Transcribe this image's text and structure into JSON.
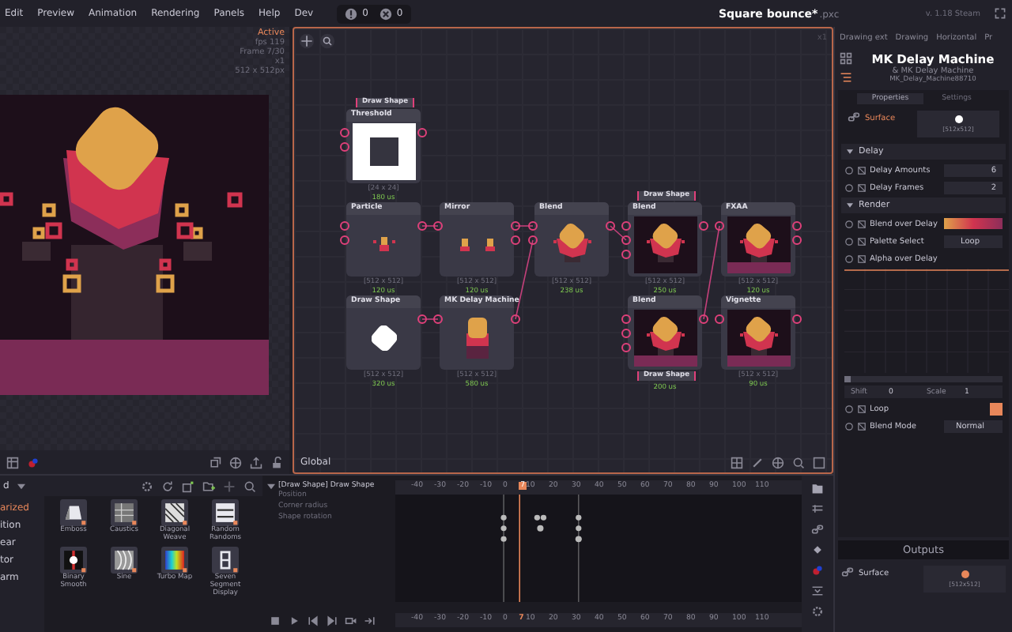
{
  "menu": [
    {
      "label": "Edit"
    },
    {
      "label": "Preview"
    },
    {
      "label": "Animation"
    },
    {
      "label": "Rendering"
    },
    {
      "label": "Panels"
    },
    {
      "label": "Help"
    },
    {
      "label": "Dev"
    }
  ],
  "counts": [
    {
      "kind": "warning",
      "count": "0"
    },
    {
      "kind": "error",
      "count": "0"
    }
  ],
  "title": "Square bounce*",
  "title_ext": ".pxc",
  "version": "v. 1.18 Steam",
  "preview": {
    "status": "Active",
    "info": [
      "fps 119",
      "Frame 7/30",
      "x1",
      "512 x 512px"
    ]
  },
  "graph": {
    "zoom": "x1",
    "scope": "Global",
    "nodes": [
      {
        "name": "Threshold",
        "tag_top": "Draw Shape",
        "size": "[24 x 24]",
        "time": "180 us",
        "kind": "frame"
      },
      {
        "name": "Particle",
        "size": "[512 x 512]",
        "time": "120 us",
        "kind": "particles"
      },
      {
        "name": "Mirror",
        "size": "[512 x 512]",
        "time": "120 us",
        "kind": "mirror"
      },
      {
        "name": "Blend",
        "size": "[512 x 512]",
        "time": "238 us",
        "kind": "sprite"
      },
      {
        "name": "Blend",
        "tag_top": "Draw Shape",
        "size": "[512 x 512]",
        "time": "250 us",
        "kind": "scene"
      },
      {
        "name": "FXAA",
        "size": "[512 x 512]",
        "time": "120 us",
        "kind": "scene_band"
      },
      {
        "name": "Draw Shape",
        "size": "[512 x 512]",
        "time": "320 us",
        "kind": "blob"
      },
      {
        "name": "MK Delay Machine",
        "size": "[512 x 512]",
        "time": "580 us",
        "kind": "tall"
      },
      {
        "name": "Blend",
        "tag_bottom": "Draw Shape",
        "time": "200 us",
        "kind": "scene_band"
      },
      {
        "name": "Vignette",
        "size": "[512 x 512]",
        "time": "90 us",
        "kind": "scene_band"
      }
    ]
  },
  "inspector": {
    "tabs": [
      {
        "label": "Drawing ext"
      },
      {
        "label": "Drawing"
      },
      {
        "label": "Horizontal"
      },
      {
        "label": "Pr"
      }
    ],
    "node_title": "MK Delay Machine",
    "node_type": "& MK Delay Machine",
    "node_id": "MK_Delay_Machine88710",
    "prop_tabs": [
      {
        "label": "Properties",
        "selected": true
      },
      {
        "label": "Settings",
        "selected": false
      }
    ],
    "input": {
      "label": "Surface",
      "size": "[512x512]"
    },
    "sections": [
      {
        "title": "Delay",
        "expanded": true,
        "props": [
          {
            "kind": "number",
            "label": "Delay Amounts",
            "value": "6"
          },
          {
            "kind": "number",
            "label": "Delay Frames",
            "value": "2"
          }
        ]
      },
      {
        "title": "Render",
        "expanded": true,
        "props": [
          {
            "kind": "gradient",
            "label": "Blend over Delay"
          },
          {
            "kind": "select",
            "label": "Palette Select",
            "value": "Loop"
          },
          {
            "kind": "curve",
            "label": "Alpha over Delay",
            "shift_label": "Shift",
            "shift": "0",
            "scale_label": "Scale",
            "scale": "1"
          },
          {
            "kind": "checkbox",
            "label": "Loop",
            "checked": true
          },
          {
            "kind": "select",
            "label": "Blend Mode",
            "value": "Normal"
          }
        ]
      }
    ],
    "outputs_title": "Outputs",
    "outputs": [
      {
        "label": "Surface",
        "size": "[512x512]"
      }
    ]
  },
  "library": {
    "category": "d",
    "groups": [
      {
        "label": "arized",
        "selected": true
      },
      {
        "label": "ition",
        "selected": false
      },
      {
        "label": "ear",
        "selected": false
      },
      {
        "label": "tor",
        "selected": false
      },
      {
        "label": "arm",
        "selected": false
      }
    ],
    "items": [
      {
        "label": "Emboss",
        "kind": "emboss"
      },
      {
        "label": "Caustics",
        "kind": "caustics"
      },
      {
        "label": "Diagonal Weave",
        "kind": "weave"
      },
      {
        "label": "Random Randoms",
        "kind": "random"
      },
      {
        "label": "Binary Smooth",
        "kind": "binary"
      },
      {
        "label": "Sine",
        "kind": "sine"
      },
      {
        "label": "Turbo Map",
        "kind": "turbo"
      },
      {
        "label": "Seven Segment Display",
        "kind": "segment"
      }
    ]
  },
  "timeline": {
    "track": "[Draw Shape] Draw Shape",
    "props": [
      "Position",
      "Corner radius",
      "Shape rotation"
    ],
    "ruler": [
      "-40",
      "-30",
      "-20",
      "-10",
      "0",
      "7",
      "10",
      "20",
      "30",
      "40",
      "50",
      "60",
      "70",
      "80",
      "90",
      "100",
      "110"
    ],
    "overview_ruler": [
      "-40",
      "-30",
      "-20",
      "-10",
      "0",
      "7",
      "10",
      "20",
      "30",
      "40",
      "50",
      "60",
      "70",
      "80",
      "90",
      "100",
      "110"
    ]
  }
}
